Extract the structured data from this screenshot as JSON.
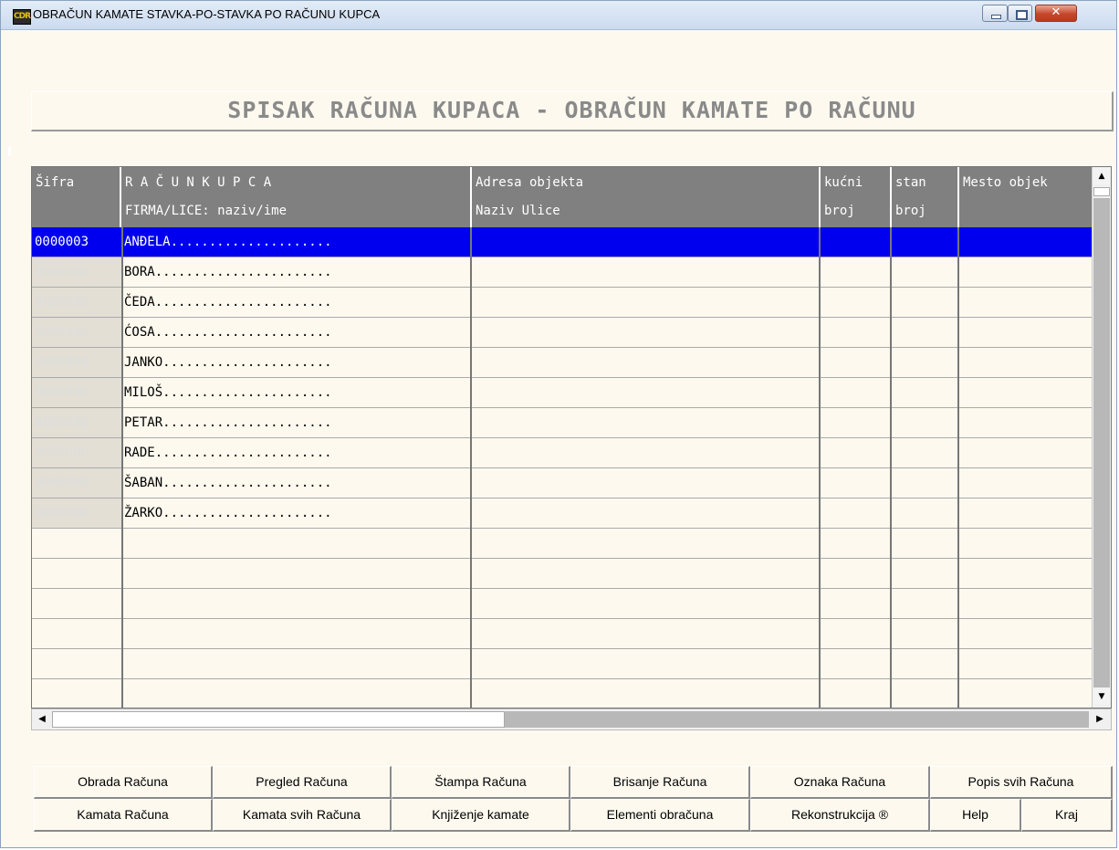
{
  "window": {
    "title": "OBRAČUN KAMATE STAVKA-PO-STAVKA PO RAČUNU KUPCA",
    "icon_text": "CDR",
    "controls": [
      "minimize-icon",
      "maximize-icon",
      "close-icon"
    ],
    "close_glyph": "✕"
  },
  "heading": "SPISAK RAČUNA KUPACA - OBRAČUN KAMATE PO RAČUNU",
  "table": {
    "columns": [
      {
        "line1": "Šifra",
        "line2": ""
      },
      {
        "line1": "R A Č U N   K U P C A",
        "line2": "FIRMA/LICE: naziv/ime"
      },
      {
        "line1": "Adresa objekta",
        "line2": "Naziv Ulice"
      },
      {
        "line1": "kućni",
        "line2": "broj"
      },
      {
        "line1": "stan",
        "line2": "broj"
      },
      {
        "line1": "Mesto objek",
        "line2": ""
      }
    ],
    "selected_code": "0000003",
    "rows": [
      "ANĐELA.....................",
      "BORA.......................",
      "ČEDA.......................",
      "ĆOSA.......................",
      "JANKO......................",
      "MILOŠ......................",
      "PETAR......................",
      "RADE.......................",
      "ŠABAN......................",
      "ŽARKO......................"
    ],
    "ghost_code": "0000000",
    "empty_rows": 6
  },
  "scroll": {
    "up": "▲",
    "down": "▼",
    "left": "◀",
    "right": "▶"
  },
  "buttons": {
    "row1": [
      "Obrada Računa",
      "Pregled Računa",
      "Štampa Računa",
      "Brisanje Računa",
      "Oznaka Računa",
      "Popis svih Računa"
    ],
    "row2": [
      "Kamata Računa",
      "Kamata svih Računa",
      "Knjiženje kamate",
      "Elementi obračuna",
      "Rekonstrukcija ®",
      "Help",
      "Kraj"
    ]
  },
  "colors": {
    "selection": "#0000ee",
    "header": "#808080",
    "background": "#fdf9ef"
  }
}
